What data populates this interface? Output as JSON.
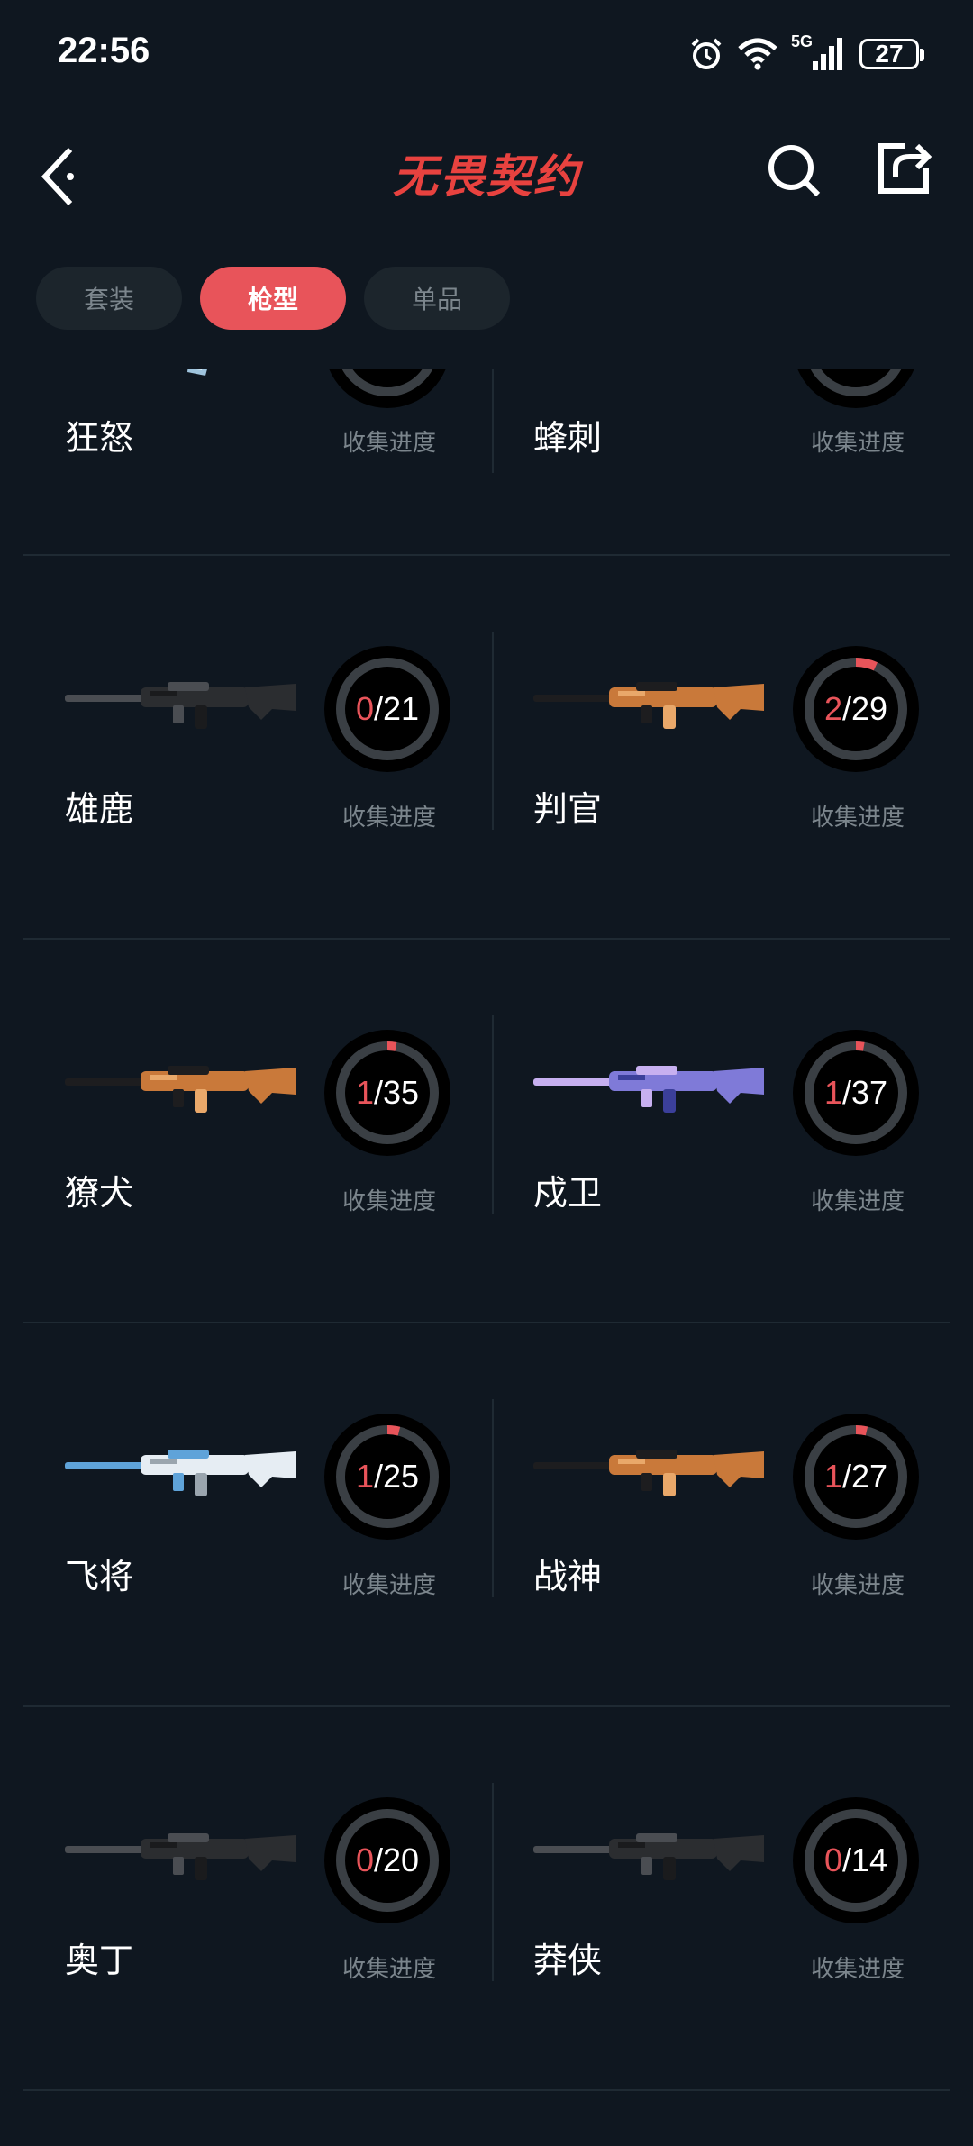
{
  "status": {
    "time": "22:56",
    "network": "5G",
    "battery": "27"
  },
  "header": {
    "title": "无畏契约"
  },
  "tabs": [
    {
      "label": "套装",
      "active": false
    },
    {
      "label": "枪型",
      "active": true
    },
    {
      "label": "单品",
      "active": false
    }
  ],
  "progress_label": "收集进度",
  "colors": {
    "accent": "#e8545a",
    "background": "#0f1720",
    "tab_bg": "#1c252c",
    "muted_text": "#7b858c"
  },
  "partial_row": [
    {
      "name": "狂怒",
      "label": "收集进度"
    },
    {
      "name": "蜂刺",
      "label": "收集进度"
    }
  ],
  "weapons": [
    {
      "name": "雄鹿",
      "owned": "0",
      "total": "21",
      "label": "收集进度",
      "fraction": 0.0,
      "tint": "dark"
    },
    {
      "name": "判官",
      "owned": "2",
      "total": "29",
      "label": "收集进度",
      "fraction": 0.069,
      "tint": "orange"
    },
    {
      "name": "獠犬",
      "owned": "1",
      "total": "35",
      "label": "收集进度",
      "fraction": 0.029,
      "tint": "orange"
    },
    {
      "name": "戍卫",
      "owned": "1",
      "total": "37",
      "label": "收集进度",
      "fraction": 0.027,
      "tint": "purple"
    },
    {
      "name": "飞将",
      "owned": "1",
      "total": "25",
      "label": "收集进度",
      "fraction": 0.04,
      "tint": "white"
    },
    {
      "name": "战神",
      "owned": "1",
      "total": "27",
      "label": "收集进度",
      "fraction": 0.037,
      "tint": "orange"
    },
    {
      "name": "奥丁",
      "owned": "0",
      "total": "20",
      "label": "收集进度",
      "fraction": 0.0,
      "tint": "dark"
    },
    {
      "name": "莽侠",
      "owned": "0",
      "total": "14",
      "label": "收集进度",
      "fraction": 0.0,
      "tint": "dark"
    }
  ]
}
